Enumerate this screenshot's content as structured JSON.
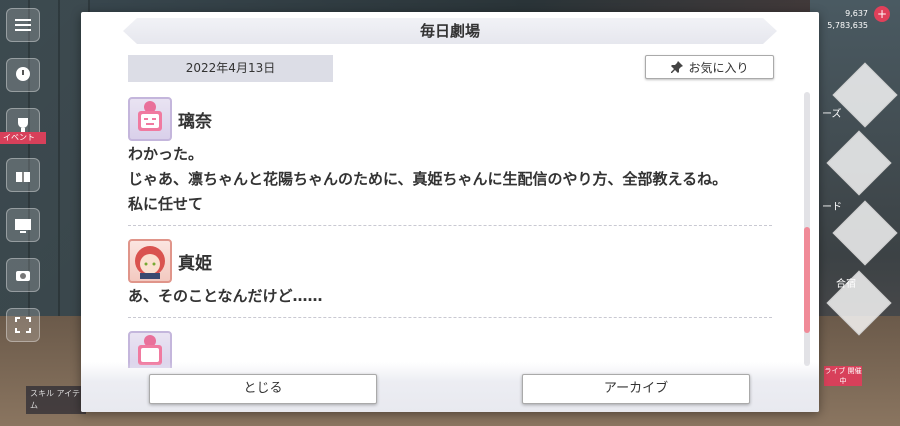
{
  "dialog": {
    "title": "毎日劇場",
    "date": "2022年4月13日",
    "favorite_label": "お気に入り",
    "close_label": "とじる",
    "archive_label": "アーカイブ"
  },
  "entries": [
    {
      "speaker": "璃奈",
      "lines": [
        "わかった。",
        "じゃあ、凛ちゃんと花陽ちゃんのために、真姫ちゃんに生配信のやり方、全部教えるね。",
        "私に任せて"
      ]
    },
    {
      "speaker": "真姫",
      "lines": [
        "あ、そのことなんだけど……"
      ]
    }
  ],
  "background": {
    "side_event_label": "イベント",
    "side_item_label": "スキル\nアイテム",
    "top_right_line1": "9,637",
    "top_right_line2": "5,783,635",
    "right_label_1": "ーズ",
    "right_label_2": "ード",
    "right_label_3": "合宿",
    "right_badge": "ライブ\n開催中"
  },
  "colors": {
    "accent_pink": "#f08a98",
    "date_bg": "#dcdde6"
  }
}
